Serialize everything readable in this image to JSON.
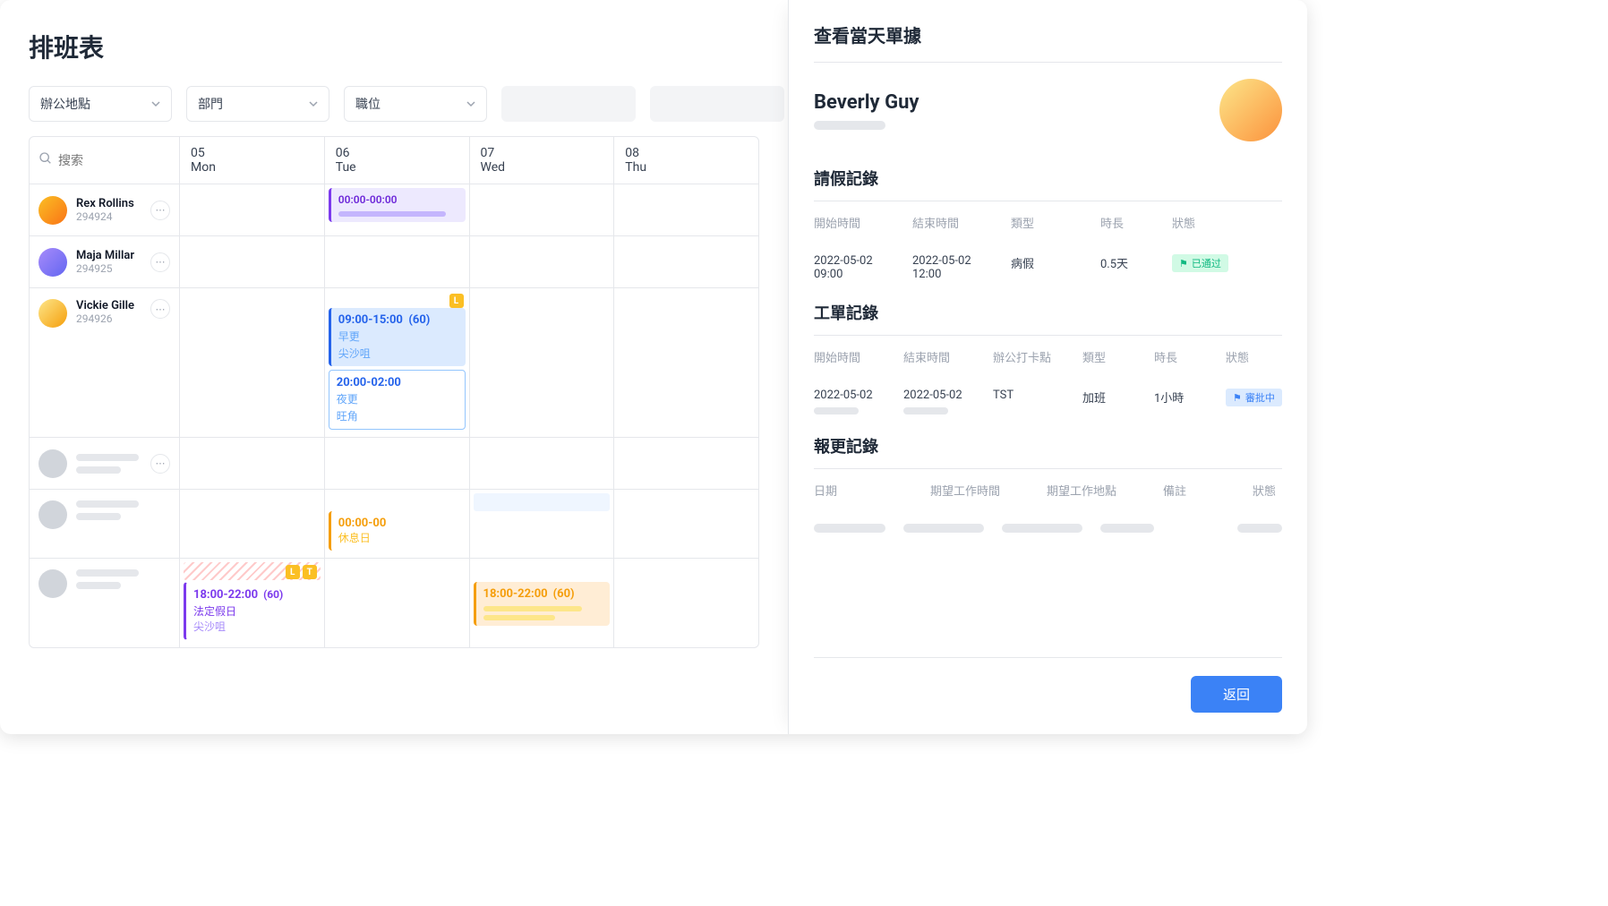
{
  "title": "排班表",
  "filters": {
    "location": "辦公地點",
    "department": "部門",
    "position": "職位"
  },
  "search_placeholder": "搜索",
  "days": [
    {
      "num": "05",
      "dow": "Mon"
    },
    {
      "num": "06",
      "dow": "Tue"
    },
    {
      "num": "07",
      "dow": "Wed"
    },
    {
      "num": "08",
      "dow": "Thu"
    }
  ],
  "employees": [
    {
      "name": "Rex Rollins",
      "id": "294924"
    },
    {
      "name": "Maja Millar",
      "id": "294925"
    },
    {
      "name": "Vickie Gille",
      "id": "294926"
    }
  ],
  "blocks": {
    "rex_tue": {
      "time": "00:00-00:00"
    },
    "vickie_tue1": {
      "time": "09:00-15:00",
      "dur": "(60)",
      "shift": "早更",
      "loc": "尖沙咀",
      "badge": "L"
    },
    "vickie_tue2": {
      "time": "20:00-02:00",
      "shift": "夜更",
      "loc": "旺角"
    },
    "orange_tue": {
      "time": "00:00-00",
      "sub": "休息日"
    },
    "purple_mon": {
      "time": "18:00-22:00",
      "dur": "(60)",
      "sub1": "法定假日",
      "sub2": "尖沙咀",
      "badge1": "L",
      "badge2": "T"
    },
    "orange_wed": {
      "time": "18:00-22:00",
      "dur": "(60)"
    }
  },
  "panel": {
    "title": "查看當天單據",
    "person": "Beverly Guy",
    "leave": {
      "heading": "請假記錄",
      "cols": {
        "start": "開始時間",
        "end": "結束時間",
        "type": "類型",
        "duration": "時長",
        "status": "狀態"
      },
      "row": {
        "start1": "2022-05-02",
        "start2": "09:00",
        "end1": "2022-05-02",
        "end2": "12:00",
        "type": "病假",
        "duration": "0.5天",
        "status": "已通过"
      }
    },
    "work": {
      "heading": "工單記錄",
      "cols": {
        "start": "開始時間",
        "end": "結束時間",
        "loc": "辦公打卡點",
        "type": "類型",
        "duration": "時長",
        "status": "狀態"
      },
      "row": {
        "start": "2022-05-02",
        "end": "2022-05-02",
        "loc": "TST",
        "type": "加班",
        "duration": "1小時",
        "status": "審批中"
      }
    },
    "shift": {
      "heading": "報更記錄",
      "cols": {
        "date": "日期",
        "time": "期望工作時間",
        "loc": "期望工作地點",
        "note": "備註",
        "status": "狀態"
      }
    },
    "back": "返回"
  }
}
